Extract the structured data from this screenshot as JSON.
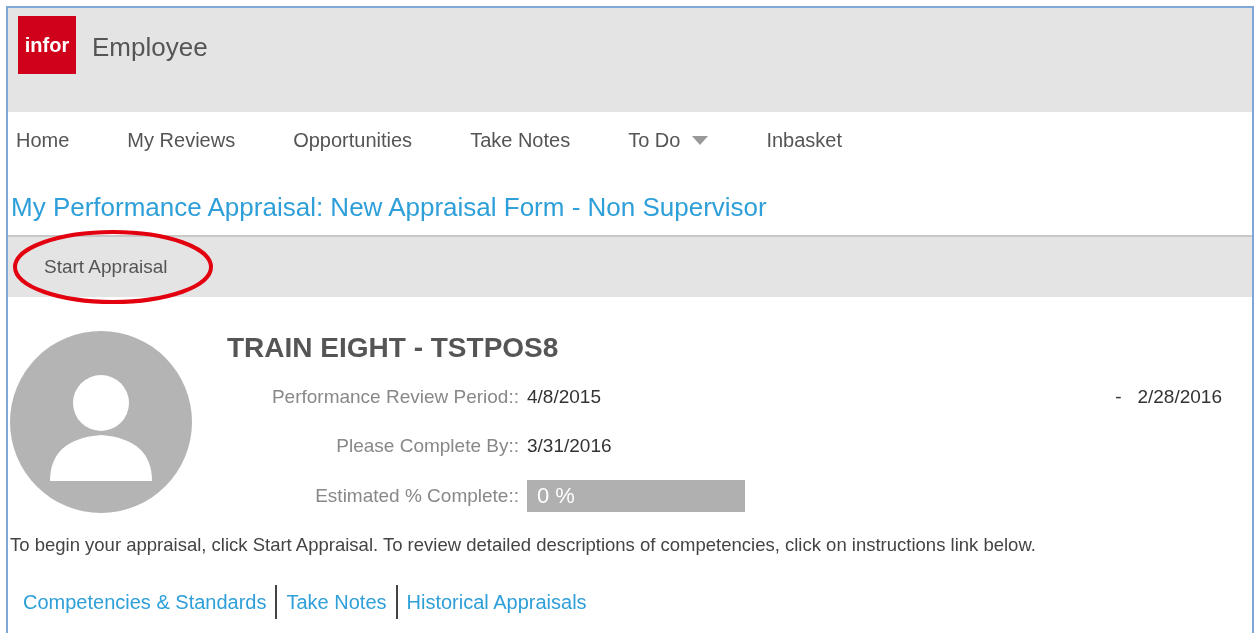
{
  "header": {
    "logo": "infor",
    "title": "Employee"
  },
  "nav": [
    {
      "label": "Home",
      "dropdown": false
    },
    {
      "label": "My Reviews",
      "dropdown": false
    },
    {
      "label": "Opportunities",
      "dropdown": false
    },
    {
      "label": "Take Notes",
      "dropdown": false
    },
    {
      "label": "To Do",
      "dropdown": true
    },
    {
      "label": "Inbasket",
      "dropdown": false
    }
  ],
  "page_title": "My Performance Appraisal: New Appraisal Form - Non Supervisor",
  "toolbar": {
    "button": "Start Appraisal",
    "circled": true
  },
  "profile": {
    "name": "TRAIN EIGHT - TSTPOS8",
    "period_label": "Performance Review Period::",
    "period_start": "4/8/2015",
    "period_sep": "-",
    "period_end": "2/28/2016",
    "complete_by_label": "Please Complete By::",
    "complete_by": "3/31/2016",
    "progress_label": "Estimated % Complete::",
    "progress_text": "0 %",
    "level": 0
  },
  "instructions": "To begin your appraisal, click Start Appraisal. To review detailed descriptions of competencies, click on instructions link below.",
  "links": [
    "Competencies & Standards",
    "Take Notes",
    "Historical Appraisals"
  ]
}
